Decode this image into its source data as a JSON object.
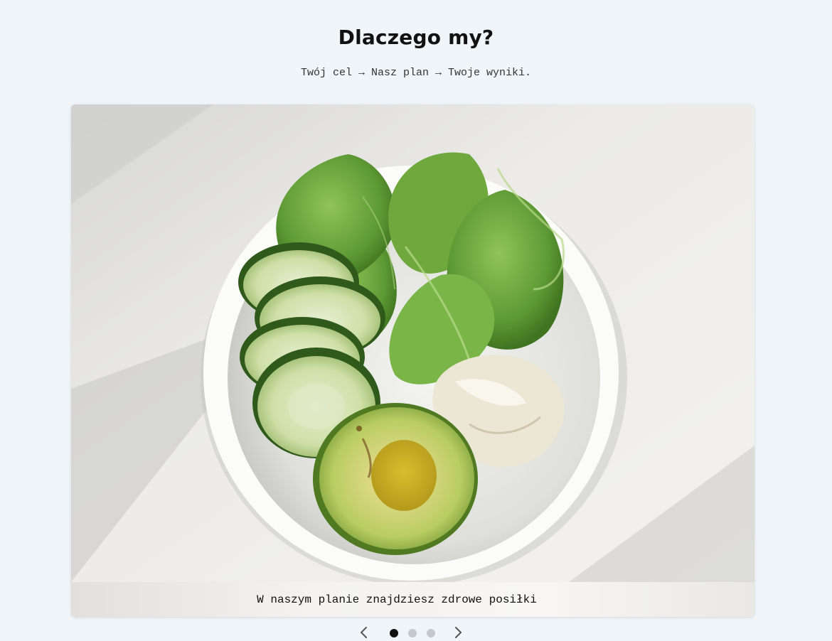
{
  "section": {
    "title": "Dlaczego my?",
    "subtitle": "Twój cel → Nasz plan → Twoje wyniki."
  },
  "carousel": {
    "slide_image_alt": "salad-bowl-with-cucumber-lettuce-avocado",
    "caption": "W naszym planie znajdziesz zdrowe posiłki",
    "prev_icon": "chevron-left-icon",
    "next_icon": "chevron-right-icon",
    "indicators": [
      {
        "active": true
      },
      {
        "active": false
      },
      {
        "active": false
      }
    ],
    "colors": {
      "dot_active": "#111111",
      "dot_inactive": "#c4c7cc",
      "arrow": "#555555"
    }
  }
}
